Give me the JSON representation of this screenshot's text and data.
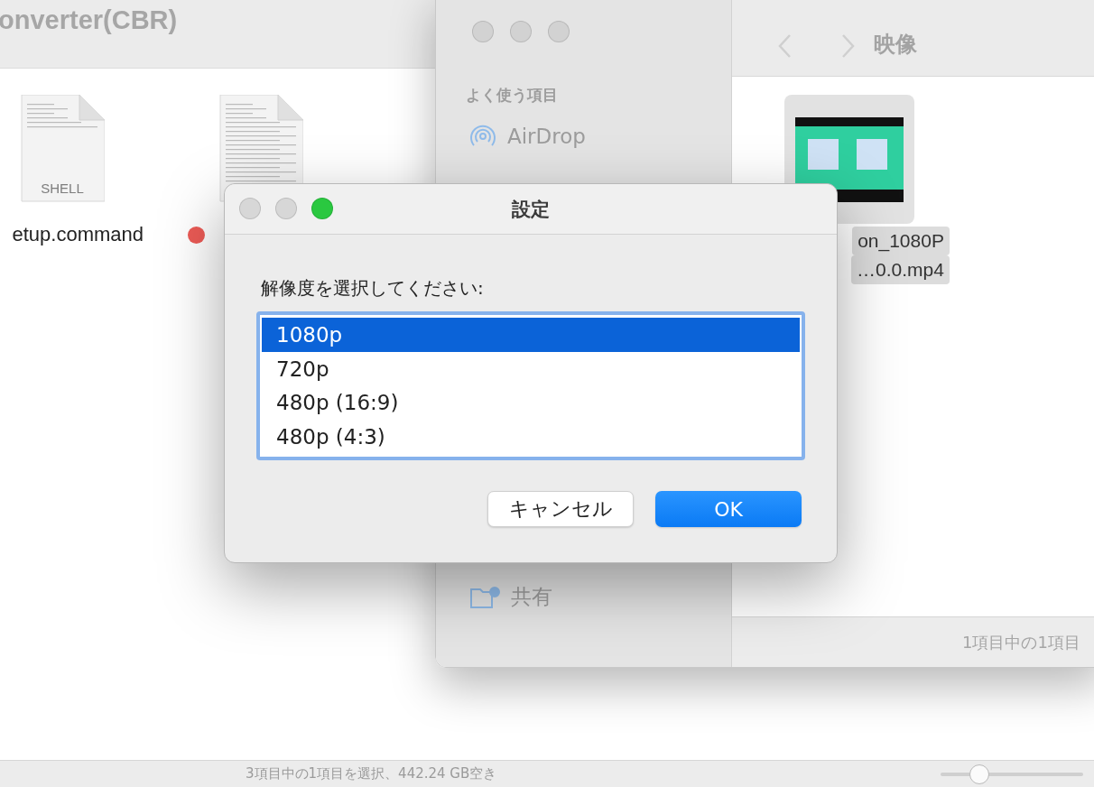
{
  "back_window": {
    "title": "onverter(CBR)",
    "files": [
      {
        "name": "etup.command",
        "kind": "shell",
        "icon_label": "SHELL"
      },
      {
        "kind": "text",
        "color": "#ec5b56"
      }
    ],
    "status": "3項目中の1項目を選択、442.24 GB空き",
    "zoom_slider": {
      "level": 0.27
    }
  },
  "finder_window": {
    "title": "映像",
    "sidebar": {
      "section": "よく使う項目",
      "items": [
        {
          "label": "AirDrop",
          "kind": "airdrop"
        },
        {
          "label": "共有",
          "kind": "shared"
        }
      ]
    },
    "files": [
      {
        "name_lines": [
          "on_1080P",
          "…0.0.mp4"
        ],
        "selected": true
      }
    ],
    "status": "1項目中の1項目"
  },
  "dialog": {
    "title": "設定",
    "prompt": "解像度を選択してください:",
    "options": [
      {
        "label": "1080p",
        "selected": true
      },
      {
        "label": "720p",
        "selected": false
      },
      {
        "label": "480p (16:9)",
        "selected": false
      },
      {
        "label": "480p (4:3)",
        "selected": false
      }
    ],
    "buttons": [
      {
        "label": "キャンセル",
        "kind": "cancel"
      },
      {
        "label": "OK",
        "kind": "default"
      }
    ]
  }
}
